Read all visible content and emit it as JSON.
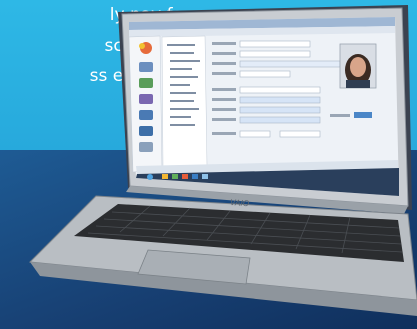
{
  "promo": {
    "lines": [
      "ly pay for",
      "scalability",
      "ss expands."
    ]
  },
  "laptop": {
    "brand": "VAIO"
  },
  "colors": {
    "sky": "#2aaee0",
    "navy": "#173f72",
    "silver": "#b9bec3",
    "keys": "#2b2d30",
    "screen_chrome": "#cfd8e4"
  }
}
